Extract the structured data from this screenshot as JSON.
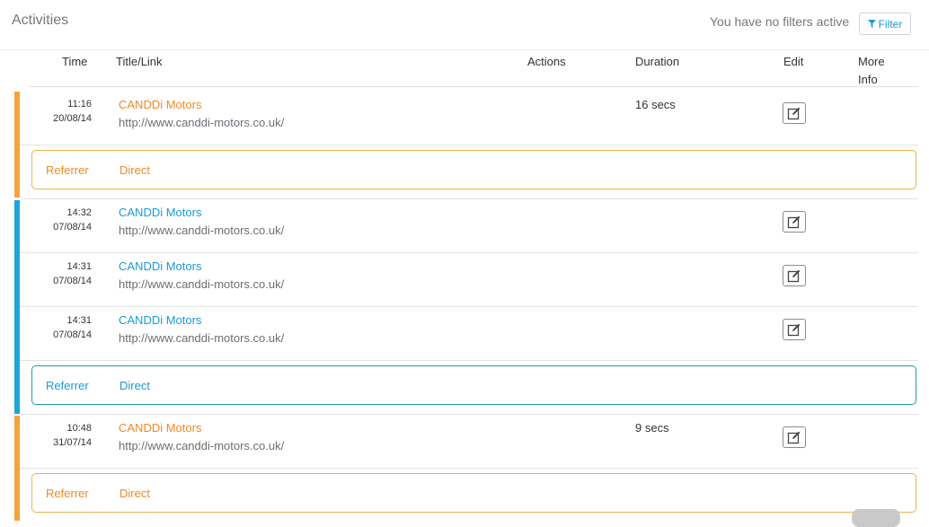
{
  "header": {
    "title": "Activities",
    "filter_status": "You have no filters active",
    "filter_label": "Filter"
  },
  "columns": {
    "time": "Time",
    "title_link": "Title/Link",
    "actions": "Actions",
    "duration": "Duration",
    "edit": "Edit",
    "more_info_1": "More",
    "more_info_2": "Info"
  },
  "colors": {
    "orange_stripe": "#f7a33b",
    "blue_stripe": "#1ea5dc",
    "orange_text": "#f08a24",
    "blue_text": "#1a9ad6"
  },
  "sessions": [
    {
      "color": "orange",
      "activities": [
        {
          "time": "11:16",
          "date": "20/08/14",
          "title": "CANDDi Motors",
          "url": "http://www.canddi-motors.co.uk/",
          "duration": "16 secs"
        }
      ],
      "referrer_label": "Referrer",
      "referrer_value": "Direct"
    },
    {
      "color": "blue",
      "activities": [
        {
          "time": "14:32",
          "date": "07/08/14",
          "title": "CANDDi Motors",
          "url": "http://www.canddi-motors.co.uk/",
          "duration": ""
        },
        {
          "time": "14:31",
          "date": "07/08/14",
          "title": "CANDDi Motors",
          "url": "http://www.canddi-motors.co.uk/",
          "duration": ""
        },
        {
          "time": "14:31",
          "date": "07/08/14",
          "title": "CANDDi Motors",
          "url": "http://www.canddi-motors.co.uk/",
          "duration": ""
        }
      ],
      "referrer_label": "Referrer",
      "referrer_value": "Direct"
    },
    {
      "color": "orange",
      "activities": [
        {
          "time": "10:48",
          "date": "31/07/14",
          "title": "CANDDi Motors",
          "url": "http://www.canddi-motors.co.uk/",
          "duration": "9 secs"
        }
      ],
      "referrer_label": "Referrer",
      "referrer_value": "Direct"
    }
  ]
}
